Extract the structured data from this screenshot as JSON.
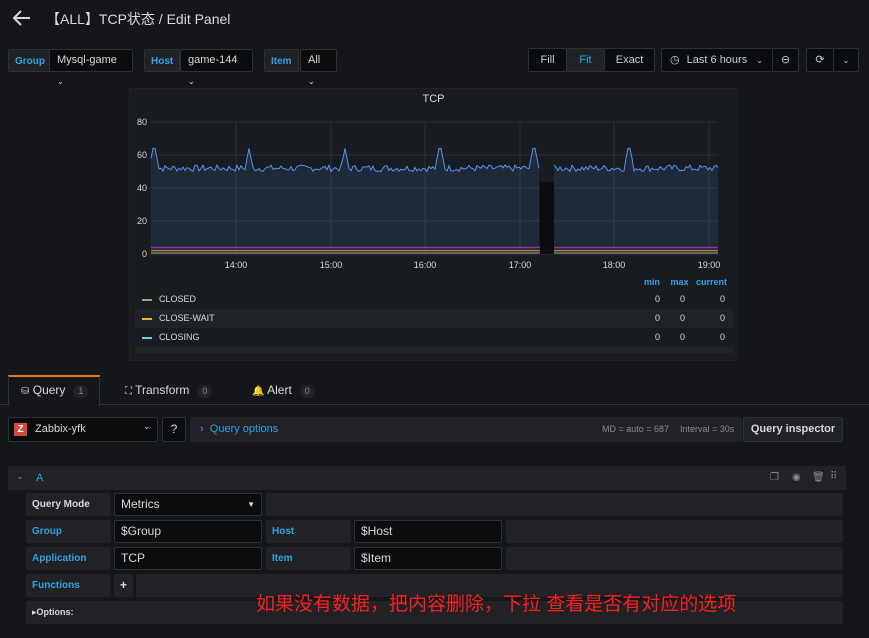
{
  "header": {
    "title": "【ALL】TCP状态 / Edit Panel"
  },
  "variables": [
    {
      "label": "Group",
      "value": "Mysql-game"
    },
    {
      "label": "Host",
      "value": "game-144"
    },
    {
      "label": "Item",
      "value": "All"
    }
  ],
  "toolbar": {
    "fill": "Fill",
    "fit": "Fit",
    "exact": "Exact",
    "time_range": "Last 6 hours"
  },
  "panel": {
    "title": "TCP"
  },
  "chart_data": {
    "type": "line",
    "title": "TCP",
    "x_ticks": [
      "14:00",
      "15:00",
      "16:00",
      "17:00",
      "18:00",
      "19:00"
    ],
    "y_ticks": [
      0,
      20,
      40,
      60,
      80
    ],
    "ylim": [
      0,
      80
    ],
    "series_note_main_level": 52,
    "gap": [
      "17:12",
      "17:22"
    ],
    "legend": {
      "headers": [
        "min",
        "max",
        "current"
      ],
      "rows": [
        {
          "name": "CLOSED",
          "color": "#7eb26d",
          "min": "0",
          "max": "0",
          "current": "0"
        },
        {
          "name": "CLOSE-WAIT",
          "color": "#eab839",
          "min": "0",
          "max": "0",
          "current": "0"
        },
        {
          "name": "CLOSING",
          "color": "#6ed0e0",
          "min": "0",
          "max": "0",
          "current": "0"
        }
      ]
    },
    "grid": true
  },
  "tabs": [
    {
      "label": "Query",
      "count": "1"
    },
    {
      "label": "Transform",
      "count": "0"
    },
    {
      "label": "Alert",
      "count": "0"
    }
  ],
  "datasource": {
    "name": "Zabbix-yfk",
    "query_options": "Query options",
    "md": "MD = auto = 687",
    "interval": "Interval = 30s",
    "inspector": "Query inspector"
  },
  "query": {
    "ref": "A",
    "mode_label": "Query Mode",
    "mode_value": "Metrics",
    "group_label": "Group",
    "group_value": "$Group",
    "host_label": "Host",
    "host_value": "$Host",
    "app_label": "Application",
    "app_value": "TCP",
    "item_label": "Item",
    "item_value": "$Item",
    "functions_label": "Functions",
    "options_label": "Options:"
  },
  "annotation": "如果没有数据，把内容删除，下拉 查看是否有对应的选项",
  "colors": {
    "accent": "#33a2e5",
    "series": "#5794f2",
    "annotation": "#ff1e1e"
  }
}
